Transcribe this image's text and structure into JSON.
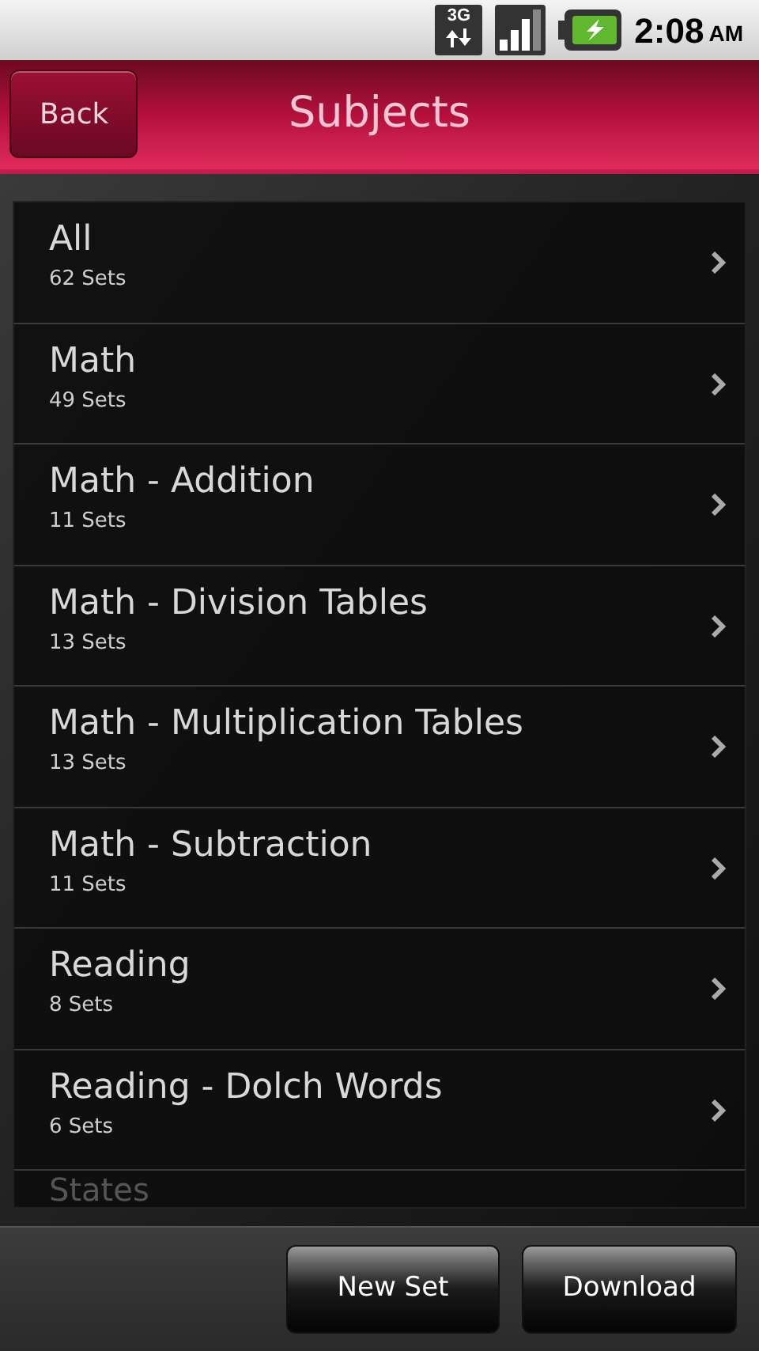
{
  "status_bar": {
    "network": "3G",
    "time": "2:08",
    "meridiem": "AM"
  },
  "header": {
    "back": "Back",
    "title": "Subjects"
  },
  "subjects": [
    {
      "name": "All",
      "count": "62 Sets"
    },
    {
      "name": "Math",
      "count": "49 Sets"
    },
    {
      "name": "Math - Addition",
      "count": "11 Sets"
    },
    {
      "name": "Math - Division Tables",
      "count": "13 Sets"
    },
    {
      "name": "Math - Multiplication Tables",
      "count": "13 Sets"
    },
    {
      "name": "Math - Subtraction",
      "count": "11 Sets"
    },
    {
      "name": "Reading",
      "count": "8 Sets"
    },
    {
      "name": "Reading - Dolch Words",
      "count": "6 Sets"
    },
    {
      "name": "States"
    }
  ],
  "buttons": [
    "New Set",
    "Download"
  ]
}
